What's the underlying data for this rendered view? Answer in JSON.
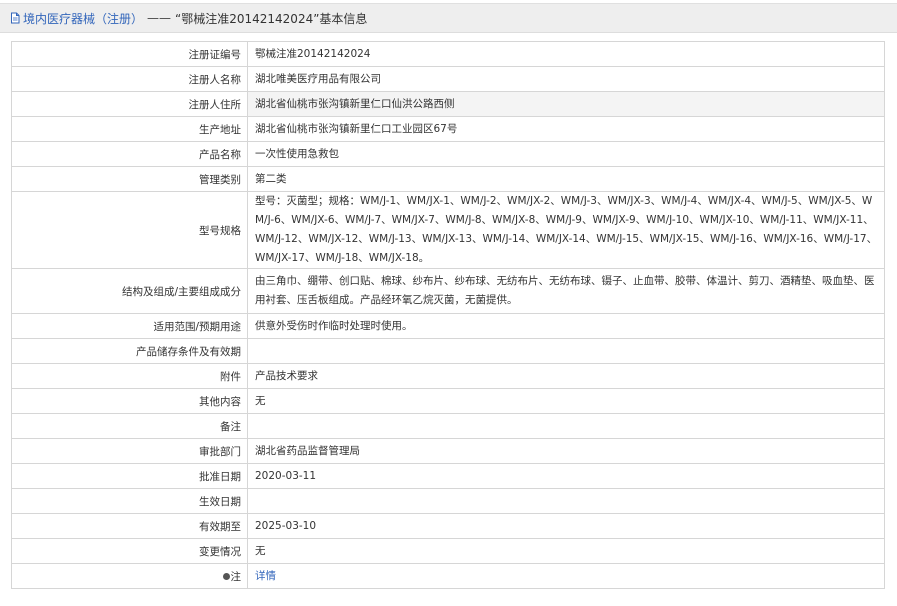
{
  "breadcrumb": {
    "link_text": "境内医疗器械（注册）",
    "separator": "——",
    "title": "“鄂械注准20142142024”基本信息"
  },
  "table": {
    "rows": [
      {
        "label": "注册证编号",
        "value": "鄂械注准20142142024"
      },
      {
        "label": "注册人名称",
        "value": "湖北唯美医疗用品有限公司"
      },
      {
        "label": "注册人住所",
        "value": "湖北省仙桃市张沟镇新里仁口仙洪公路西侧"
      },
      {
        "label": "生产地址",
        "value": "湖北省仙桃市张沟镇新里仁口工业园区67号"
      },
      {
        "label": "产品名称",
        "value": "一次性使用急救包"
      },
      {
        "label": "管理类别",
        "value": "第二类"
      },
      {
        "label": "型号规格",
        "value": "型号：灭菌型；规格：WM/J-1、WM/JX-1、WM/J-2、WM/JX-2、WM/J-3、WM/JX-3、WM/J-4、WM/JX-4、WM/J-5、WM/JX-5、WM/J-6、WM/JX-6、WM/J-7、WM/JX-7、WM/J-8、WM/JX-8、WM/J-9、WM/JX-9、WM/J-10、WM/JX-10、WM/J-11、WM/JX-11、WM/J-12、WM/JX-12、WM/J-13、WM/JX-13、WM/J-14、WM/JX-14、WM/J-15、WM/JX-15、WM/J-16、WM/JX-16、WM/J-17、WM/JX-17、WM/J-18、WM/JX-18。"
      },
      {
        "label": "结构及组成/主要组成成分",
        "value": "由三角巾、绷带、创口贴、棉球、纱布片、纱布球、无纺布片、无纺布球、镊子、止血带、胶带、体温计、剪刀、酒精垫、吸血垫、医用衬套、压舌板组成。产品经环氧乙烷灭菌，无菌提供。"
      },
      {
        "label": "适用范围/预期用途",
        "value": "供意外受伤时作临时处理时使用。"
      },
      {
        "label": "产品储存条件及有效期",
        "value": ""
      },
      {
        "label": "附件",
        "value": "产品技术要求"
      },
      {
        "label": "其他内容",
        "value": "无"
      },
      {
        "label": "备注",
        "value": ""
      },
      {
        "label": "审批部门",
        "value": "湖北省药品监督管理局"
      },
      {
        "label": "批准日期",
        "value": "2020-03-11"
      },
      {
        "label": "生效日期",
        "value": ""
      },
      {
        "label": "有效期至",
        "value": "2025-03-10"
      },
      {
        "label": "变更情况",
        "value": "无"
      },
      {
        "label": "注",
        "value": "详情"
      }
    ]
  }
}
